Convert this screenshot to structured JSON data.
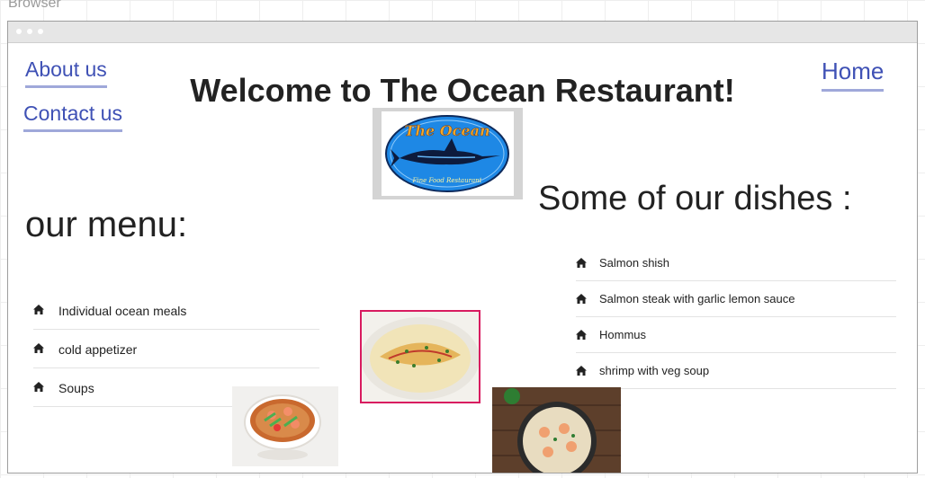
{
  "app": {
    "window_label": "Browser"
  },
  "nav": {
    "about_label": "About us",
    "contact_label": "Contact us",
    "home_label": "Home"
  },
  "header": {
    "title": "Welcome to The Ocean Restaurant!"
  },
  "logo": {
    "name_text": "The Ocean",
    "tagline_text": "Fine Food Restaurant"
  },
  "menu": {
    "heading": "our menu:",
    "items": [
      {
        "label": "Individual ocean meals",
        "icon": "home-icon"
      },
      {
        "label": "cold appetizer",
        "icon": "home-icon"
      },
      {
        "label": "Soups",
        "icon": "home-icon"
      }
    ]
  },
  "dishes": {
    "heading": "Some of our dishes :",
    "items": [
      {
        "label": "Salmon shish",
        "icon": "home-icon"
      },
      {
        "label": "Salmon steak with garlic lemon sauce",
        "icon": "home-icon"
      },
      {
        "label": "Hommus",
        "icon": "home-icon"
      },
      {
        "label": "shrimp with veg soup",
        "icon": "home-icon"
      }
    ]
  },
  "colors": {
    "link": "#3f51b5",
    "link_underline": "#9fa8da",
    "highlight_border": "#d81b60",
    "text": "#222222"
  }
}
